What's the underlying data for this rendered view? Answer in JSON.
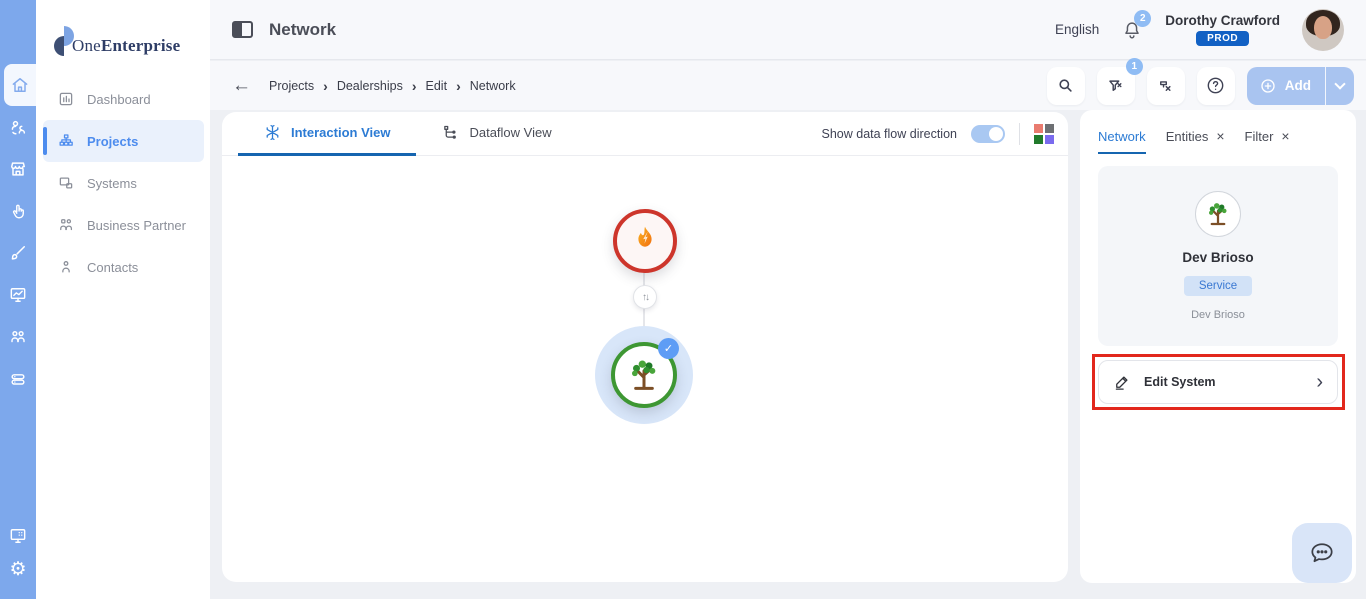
{
  "brand": {
    "name_regular": "One",
    "name_bold": "Enterprise"
  },
  "rail": {
    "icons": [
      "home-icon",
      "team-sync-icon",
      "store-icon",
      "tap-hand-icon",
      "brush-icon",
      "monitor-chart-icon",
      "partners-icon",
      "server-icon",
      "monitor-apps-icon",
      "gear-icon"
    ],
    "active": "home-icon"
  },
  "sidebar": {
    "items": [
      {
        "icon": "dashboard-icon",
        "label": "Dashboard",
        "active": false
      },
      {
        "icon": "projects-icon",
        "label": "Projects",
        "active": true
      },
      {
        "icon": "systems-icon",
        "label": "Systems",
        "active": false
      },
      {
        "icon": "business-partner-icon",
        "label": "Business Partner",
        "active": false
      },
      {
        "icon": "contacts-icon",
        "label": "Contacts",
        "active": false
      }
    ]
  },
  "header": {
    "title": "Network",
    "language": "English",
    "notification_count": "2",
    "user": {
      "name": "Dorothy Crawford",
      "environment": "PROD"
    }
  },
  "breadcrumbs": {
    "items": [
      "Projects",
      "Dealerships",
      "Edit",
      "Network"
    ],
    "separator": "›"
  },
  "toolbar": {
    "filter_badge": "1",
    "add_label": "Add"
  },
  "view": {
    "tabs": [
      {
        "label": "Interaction View",
        "active": true
      },
      {
        "label": "Dataflow View",
        "active": false
      }
    ],
    "flow_toggle": {
      "label": "Show data flow direction",
      "on": true
    }
  },
  "diagram": {
    "nodes": [
      {
        "id": "flame-node",
        "icon": "flame-icon",
        "ring_color": "#cd352b",
        "selected": false
      },
      {
        "id": "tree-node",
        "icon": "tree-icon",
        "ring_color": "#3e9733",
        "selected": true
      }
    ],
    "link": {
      "type": "bidirectional",
      "arrows": "↑↓"
    },
    "check_mark": "✓"
  },
  "inspector": {
    "tabs": [
      {
        "label": "Network",
        "active": true,
        "closable": false
      },
      {
        "label": "Entities",
        "active": false,
        "closable": true
      },
      {
        "label": "Filter",
        "active": false,
        "closable": true
      }
    ],
    "close_glyph": "×",
    "card": {
      "title": "Dev Brioso",
      "badge": "Service",
      "subtitle": "Dev Brioso"
    },
    "actions": [
      {
        "label": "Edit System"
      }
    ]
  },
  "colors": {
    "rail": "#7da8ec",
    "accent": "#2c7bd4",
    "tab_underline": "#1565b0",
    "prod_badge": "#1261c4",
    "count_badge": "#8fbcf4",
    "add_button": "#a9c4f0",
    "node_red_ring": "#cd352b",
    "node_green_ring": "#3e9733",
    "selection_halo": "#d8e6f9",
    "service_pill_bg": "#d2e2f7",
    "service_pill_text": "#3a78d2",
    "highlight_red": "#e2271c",
    "grid_icon": [
      "#e97b6f",
      "#6d6f73",
      "#217a2b",
      "#7a6bee"
    ]
  },
  "misc": {
    "back_arrow": "←"
  }
}
